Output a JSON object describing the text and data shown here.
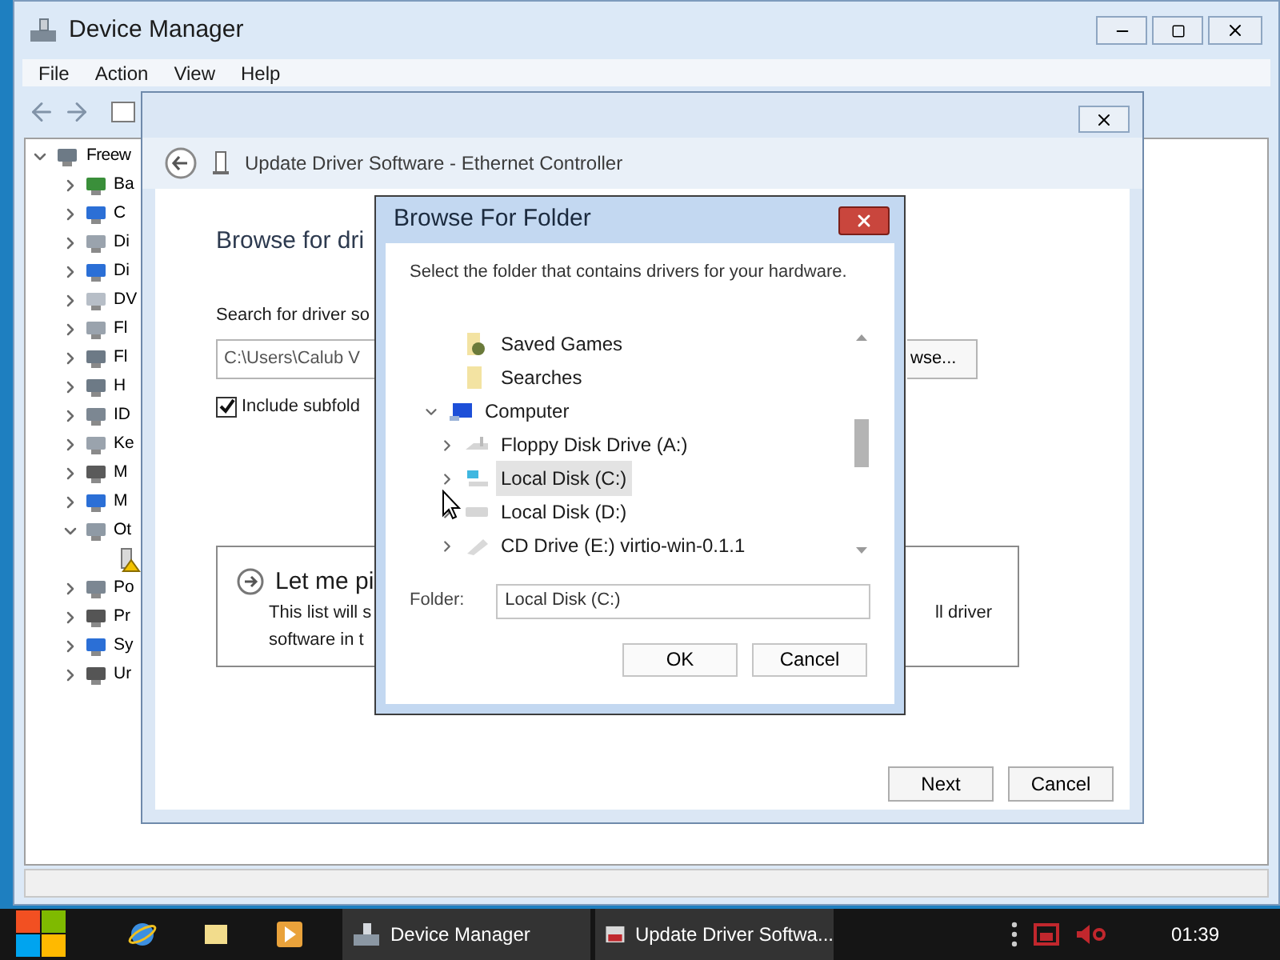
{
  "device_manager": {
    "title": "Device Manager",
    "menu": [
      "File",
      "Action",
      "View",
      "Help"
    ],
    "tree": {
      "label": "Freew",
      "expanded": true,
      "children": [
        {
          "label": "Ba",
          "expanded": false
        },
        {
          "label": "C",
          "expanded": false
        },
        {
          "label": "Di",
          "expanded": false
        },
        {
          "label": "Di",
          "expanded": false
        },
        {
          "label": "DV",
          "expanded": false
        },
        {
          "label": "Fl",
          "expanded": false
        },
        {
          "label": "Fl",
          "expanded": false
        },
        {
          "label": "H",
          "expanded": false
        },
        {
          "label": "ID",
          "expanded": false
        },
        {
          "label": "Ke",
          "expanded": false
        },
        {
          "label": "M",
          "expanded": false
        },
        {
          "label": "M",
          "expanded": false
        },
        {
          "label": "Ot",
          "expanded": true,
          "children": [
            {
              "kind": "unknown-device"
            }
          ]
        },
        {
          "label": "Po",
          "expanded": false
        },
        {
          "label": "Pr",
          "expanded": false
        },
        {
          "label": "Sy",
          "expanded": false
        },
        {
          "label": "Ur",
          "expanded": false
        }
      ]
    }
  },
  "update_dialog": {
    "title": "Update Driver Software - Ethernet Controller",
    "heading": "Browse for dri",
    "search_label": "Search for driver so",
    "path_field": {
      "value": "C:\\Users\\Calub V"
    },
    "browse_button": "wse...",
    "include_subfolders": {
      "label": "Include subfold",
      "checked": true
    },
    "option": {
      "title": "Let me pi",
      "line_1": "This list will s",
      "line_1_tail": "ll driver",
      "line_2": "software in t"
    },
    "buttons": [
      "Next",
      "Cancel"
    ]
  },
  "browse_dialog": {
    "title": "Browse For Folder",
    "instruction": "Select the folder that contains drivers for your hardware.",
    "tree": [
      {
        "children": [
          {
            "label": "Saved Games",
            "kind": "games-folder",
            "selected": false
          },
          {
            "label": "Searches",
            "kind": "folder",
            "selected": false
          }
        ]
      },
      {
        "label": "Computer",
        "kind": "computer",
        "expanded": true,
        "selected": false,
        "children": [
          {
            "label": "Floppy Disk Drive (A:)",
            "kind": "floppy",
            "expanded": false,
            "selected": false
          },
          {
            "label": "Local Disk (C:)",
            "kind": "system-disk",
            "expanded": false,
            "selected": true
          },
          {
            "label": "Local Disk (D:)",
            "kind": "disk",
            "expanded": false,
            "selected": false
          },
          {
            "label": "CD Drive (E:) virtio-win-0.1.1",
            "kind": "cd",
            "expanded": false,
            "selected": false
          }
        ]
      }
    ],
    "folder_label": "Folder:",
    "folder_value": "Local Disk (C:)",
    "buttons": [
      "OK",
      "Cancel"
    ]
  },
  "taskbar": {
    "items": [
      {
        "kind": "start"
      },
      {
        "kind": "browser"
      },
      {
        "kind": "folder"
      },
      {
        "kind": "media"
      },
      {
        "kind": "window",
        "label": "Device Manager"
      },
      {
        "kind": "window",
        "label": "Update Driver Softwa..."
      }
    ],
    "clock": "01:39"
  }
}
